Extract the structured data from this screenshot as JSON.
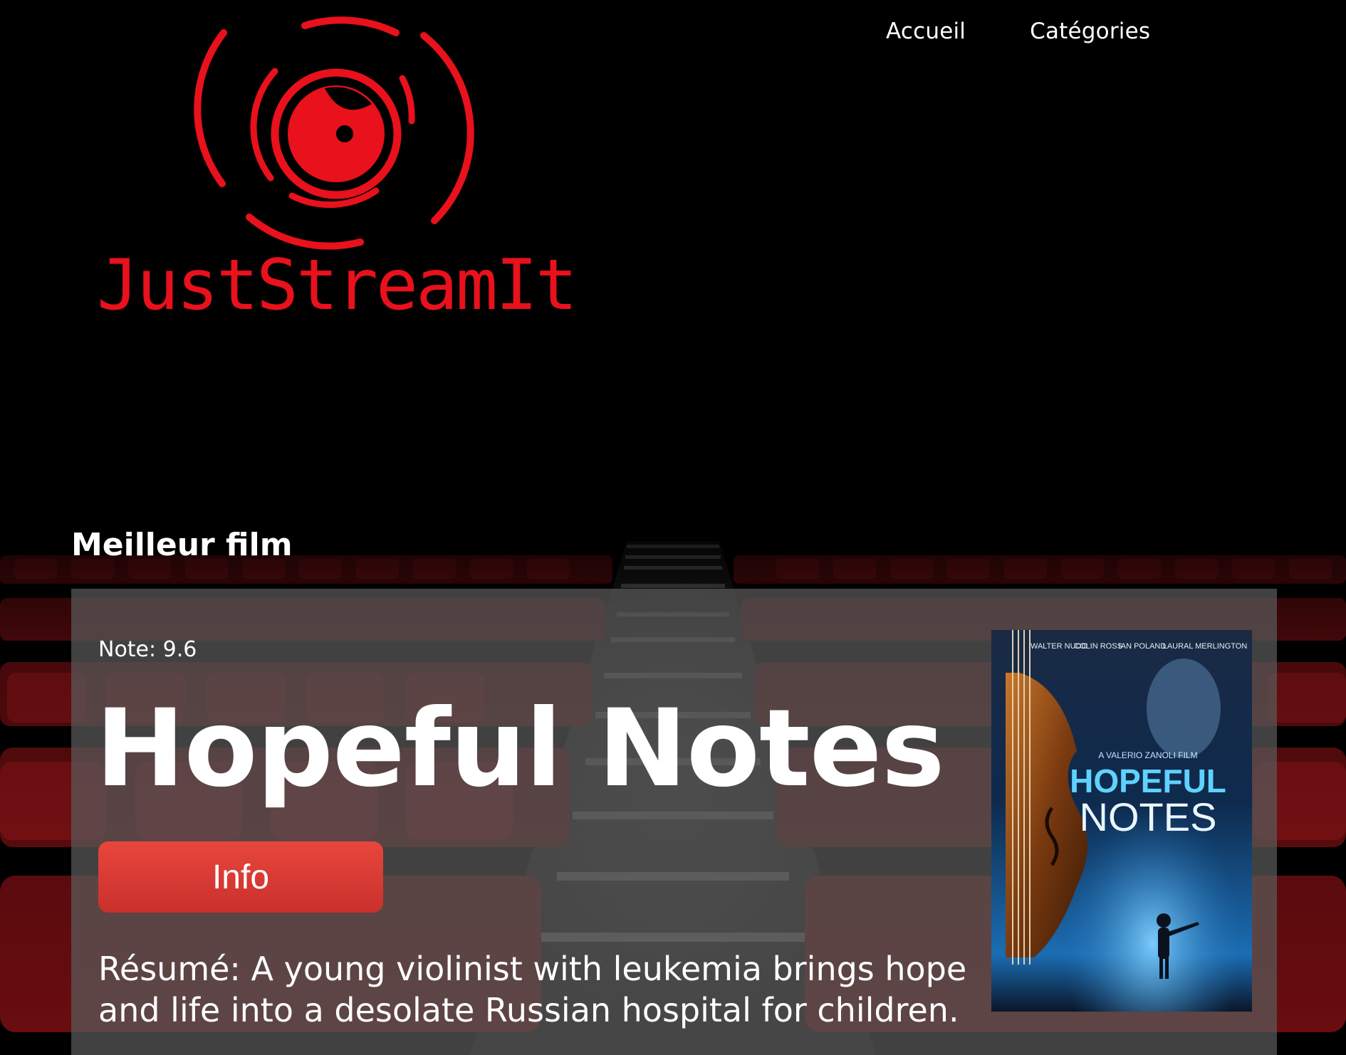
{
  "app": {
    "brand_text_regular": "Just",
    "brand_text_accent": "Stream",
    "brand_text_regular2": "am",
    "brand_text_end": "It",
    "brand_name": "JustStreamIt",
    "brand_color": "#e8111c"
  },
  "nav": {
    "items": [
      {
        "label": "Accueil"
      },
      {
        "label": "Catégories"
      }
    ]
  },
  "best_movie": {
    "section_title": "Meilleur film",
    "rating_text": "Note: 9.6",
    "title": "Hopeful Notes",
    "info_button_label": "Info",
    "summary": "Résumé: A young violinist with leukemia brings hope and life into a desolate Russian hospital for children.",
    "poster": {
      "cast": [
        "WALTER NUDO",
        "COLIN ROSS",
        "IAN POLAND",
        "LAURAL MERLINGTON"
      ],
      "credit": "A VALERIO ZANOLI FILM",
      "title_line1": "HOPEFUL",
      "title_line2": "NOTES"
    }
  },
  "colors": {
    "accent": "#e8111c",
    "button": "#d93a33",
    "card_bg": "rgba(90,90,90,0.72)"
  }
}
